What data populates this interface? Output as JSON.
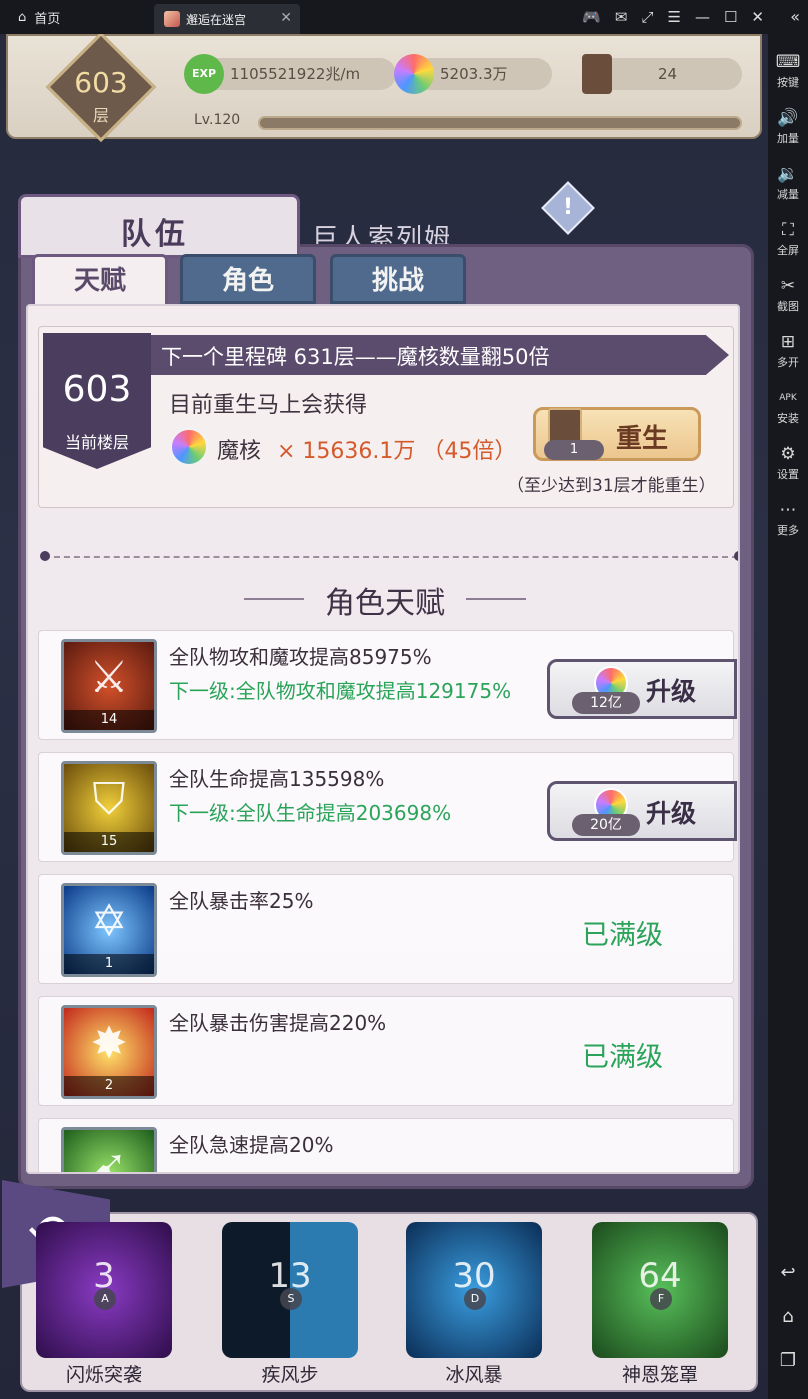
{
  "window": {
    "home_tab": "首页",
    "game_tab": "邂逅在迷宫"
  },
  "sidebar": [
    {
      "label": "按键",
      "icon": "keyboard-icon"
    },
    {
      "label": "加量",
      "icon": "volume-up-icon"
    },
    {
      "label": "减量",
      "icon": "volume-down-icon"
    },
    {
      "label": "全屏",
      "icon": "fullscreen-icon"
    },
    {
      "label": "截图",
      "icon": "scissors-icon"
    },
    {
      "label": "多开",
      "icon": "multi-open-icon"
    },
    {
      "label": "安装",
      "icon": "apk-icon"
    },
    {
      "label": "设置",
      "icon": "gear-icon"
    },
    {
      "label": "更多",
      "icon": "more-icon"
    }
  ],
  "hud": {
    "floor": "603",
    "floor_unit": "层",
    "exp_badge": "EXP",
    "exp_rate": "1105521922兆/m",
    "magic_core": "5203.3万",
    "books": "24",
    "level": "Lv.120",
    "level_progress": 0.0
  },
  "background": {
    "boss_name": "巨人索列姆"
  },
  "panel": {
    "title": "队伍",
    "tabs": [
      {
        "label": "天赋",
        "active": true
      },
      {
        "label": "角色",
        "active": false
      },
      {
        "label": "挑战",
        "active": false
      }
    ],
    "milestone": {
      "floor": "603",
      "floor_label": "当前楼层",
      "banner": "下一个里程碑 631层——魔核数量翻50倍",
      "line1": "目前重生马上会获得",
      "reward_name": "魔核",
      "reward_value": "× 15636.1万 （45倍）",
      "rebirth_label": "重生",
      "rebirth_count": "1",
      "note": "（至少达到31层才能重生）"
    },
    "section_title": "角色天赋",
    "talents": [
      {
        "name": "全队物攻和魔攻提高85975%",
        "next": "下一级:全队物攻和魔攻提高129175%",
        "level": "14",
        "icon": "sword-icon",
        "cost": "12亿",
        "action": "升级",
        "maxed": false
      },
      {
        "name": "全队生命提高135598%",
        "next": "下一级:全队生命提高203698%",
        "level": "15",
        "icon": "shield-icon",
        "cost": "20亿",
        "action": "升级",
        "maxed": false
      },
      {
        "name": "全队暴击率25%",
        "next": "",
        "level": "1",
        "icon": "hexagram-icon",
        "max_label": "已满级",
        "maxed": true
      },
      {
        "name": "全队暴击伤害提高220%",
        "next": "",
        "level": "2",
        "icon": "burst-icon",
        "max_label": "已满级",
        "maxed": true
      },
      {
        "name": "全队急速提高20%",
        "next": "",
        "level": "",
        "icon": "speed-icon",
        "maxed": false
      }
    ]
  },
  "skills": [
    {
      "name": "闪烁突袭",
      "cooldown": "3",
      "key": "A"
    },
    {
      "name": "疾风步",
      "cooldown": "13",
      "key": "S"
    },
    {
      "name": "冰风暴",
      "cooldown": "30",
      "key": "D"
    },
    {
      "name": "神恩笼罩",
      "cooldown": "64",
      "key": "F"
    }
  ]
}
